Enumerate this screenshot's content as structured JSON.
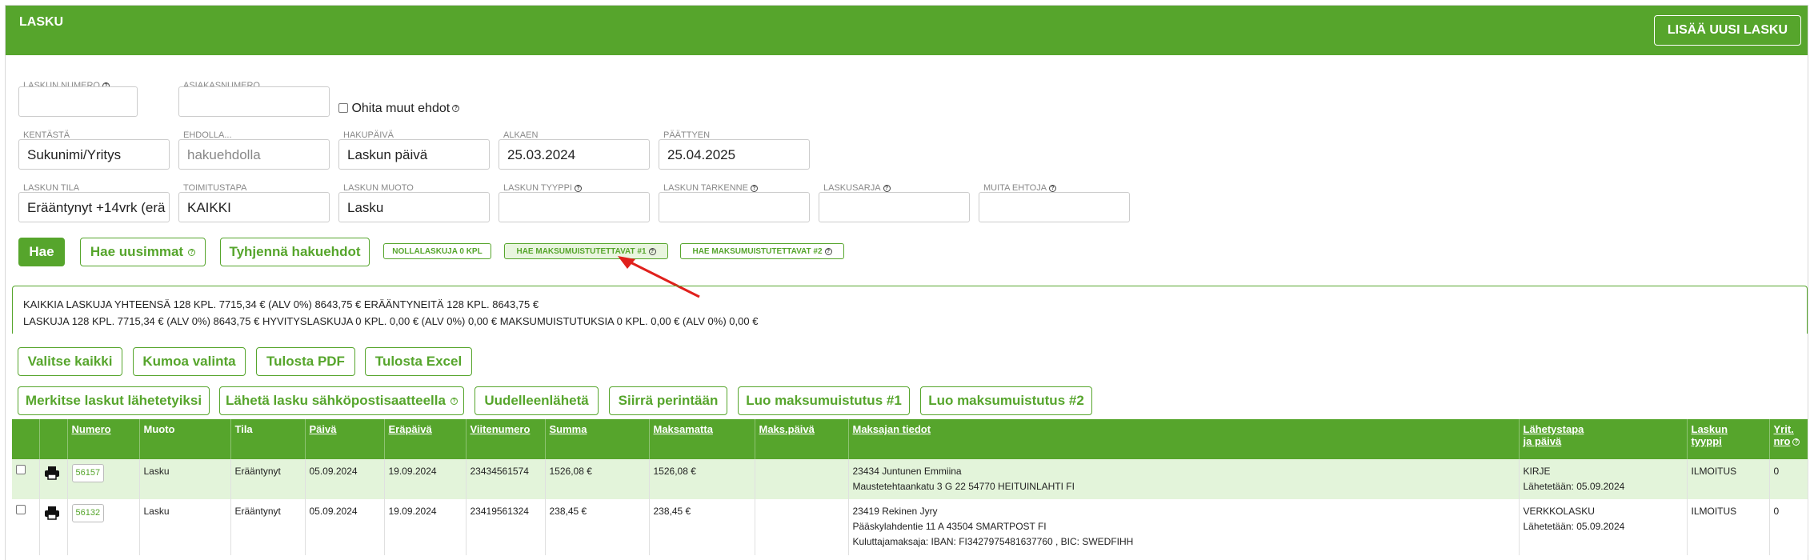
{
  "header": {
    "title": "LASKU",
    "add_button": "LISÄÄ UUSI LASKU"
  },
  "filters": {
    "row1": {
      "invoice_number": {
        "label": "LASKUN NUMERO",
        "value": ""
      },
      "customer_number": {
        "label": "ASIAKASNUMERO",
        "value": ""
      },
      "ignore_other": "Ohita muut ehdot"
    },
    "row2": {
      "field": {
        "label": "KENTÄSTÄ",
        "value": "Sukunimi/Yritys"
      },
      "condition": {
        "label": "EHDOLLA...",
        "placeholder": "hakuehdolla"
      },
      "search_date": {
        "label": "HAKUPÄIVÄ",
        "value": "Laskun päivä"
      },
      "start": {
        "label": "ALKAEN",
        "value": "25.03.2024"
      },
      "end": {
        "label": "PÄÄTTYEN",
        "value": "25.04.2025"
      }
    },
    "row3": {
      "status": {
        "label": "LASKUN TILA",
        "value": "Erääntynyt +14vrk (erä"
      },
      "delivery": {
        "label": "TOIMITUSTAPA",
        "value": "KAIKKI"
      },
      "format": {
        "label": "LASKUN MUOTO",
        "value": "Lasku"
      },
      "type": {
        "label": "LASKUN TYYPPI",
        "value": ""
      },
      "specifier": {
        "label": "LASKUN TARKENNE",
        "value": ""
      },
      "series": {
        "label": "LASKUSARJA",
        "value": ""
      },
      "other": {
        "label": "MUITA EHTOJA",
        "value": ""
      }
    }
  },
  "search_buttons": {
    "search": "Hae",
    "latest": "Hae uusimmat",
    "clear": "Tyhjennä hakuehdot",
    "zero_invoices": "NOLLALASKUJA 0 KPL",
    "reminder1": "HAE MAKSUMUISTUTETTAVAT #1",
    "reminder2": "HAE MAKSUMUISTUTETTAVAT #2"
  },
  "summary": {
    "line1": "KAIKKIA LASKUJA YHTEENSÄ 128 KPL. 7715,34 € (ALV 0%)  8643,75 € ERÄÄNTYNEITÄ 128 KPL. 8643,75 €",
    "line2": "LASKUJA 128 KPL. 7715,34 € (ALV 0%)  8643,75 €   HYVITYSLASKUJA 0 KPL. 0,00 € (ALV 0%)  0,00 €   MAKSUMUISTUTUKSIA 0 KPL. 0,00 € (ALV 0%)  0,00 €"
  },
  "actions": {
    "select_all": "Valitse kaikki",
    "deselect": "Kumoa valinta",
    "print_pdf": "Tulosta PDF",
    "print_excel": "Tulosta Excel",
    "mark_sent": "Merkitse laskut lähetetyiksi",
    "send_email": "Lähetä lasku sähköpostisaatteella",
    "resend": "Uudelleenlähetä",
    "collection": "Siirrä perintään",
    "create_rem1": "Luo maksumuistutus #1",
    "create_rem2": "Luo maksumuistutus #2"
  },
  "table": {
    "headers": {
      "numero": "Numero",
      "muoto": "Muoto",
      "tila": "Tila",
      "paiva": "Päivä",
      "erapaiva": "Eräpäivä",
      "viite": "Viitenumero",
      "summa": "Summa",
      "maksamatta": "Maksamatta",
      "maks_paiva": "Maks.päivä",
      "maksajan": "Maksajan tiedot",
      "lahetystapa_1": "Lähetystapa",
      "lahetystapa_2": "ja päivä",
      "laskun_1": "Laskun",
      "laskun_2": "tyyppi",
      "yrit_1": "Yrit.",
      "yrit_2": "nro"
    },
    "rows": [
      {
        "numero": "56157",
        "muoto": "Lasku",
        "tila": "Erääntynyt",
        "paiva": "05.09.2024",
        "erapaiva": "19.09.2024",
        "viite": "23434561574",
        "summa": "1526,08 €",
        "maksamatta": "1526,08 €",
        "maks_paiva": "",
        "payer_1": "23434 Juntunen Emmiina",
        "payer_2": "Maustetehtaankatu 3 G 22 54770 HEITUINLAHTI FI",
        "payer_3": "",
        "lahetys_1": "KIRJE",
        "lahetys_2": "Lähetetään: 05.09.2024",
        "tyyppi": "ILMOITUS",
        "yrit": "0"
      },
      {
        "numero": "56132",
        "muoto": "Lasku",
        "tila": "Erääntynyt",
        "paiva": "05.09.2024",
        "erapaiva": "19.09.2024",
        "viite": "23419561324",
        "summa": "238,45 €",
        "maksamatta": "238,45 €",
        "maks_paiva": "",
        "payer_1": "23419 Rekinen Jyry",
        "payer_2": "Pääskylahdentie 11 A 43504 SMARTPOST FI",
        "payer_3": "Kuluttajamaksaja: IBAN: FI3427975481637760 , BIC: SWEDFIHH",
        "lahetys_1": "VERKKOLASKU",
        "lahetys_2": "Lähetetään: 05.09.2024",
        "tyyppi": "ILMOITUS",
        "yrit": "0"
      }
    ]
  },
  "colors": {
    "brand": "#56a52c",
    "row_highlight": "#e3f4da",
    "annotation_arrow": "#e0201c"
  },
  "icons": {
    "print": "printer-icon",
    "help": "help-circle-icon"
  }
}
